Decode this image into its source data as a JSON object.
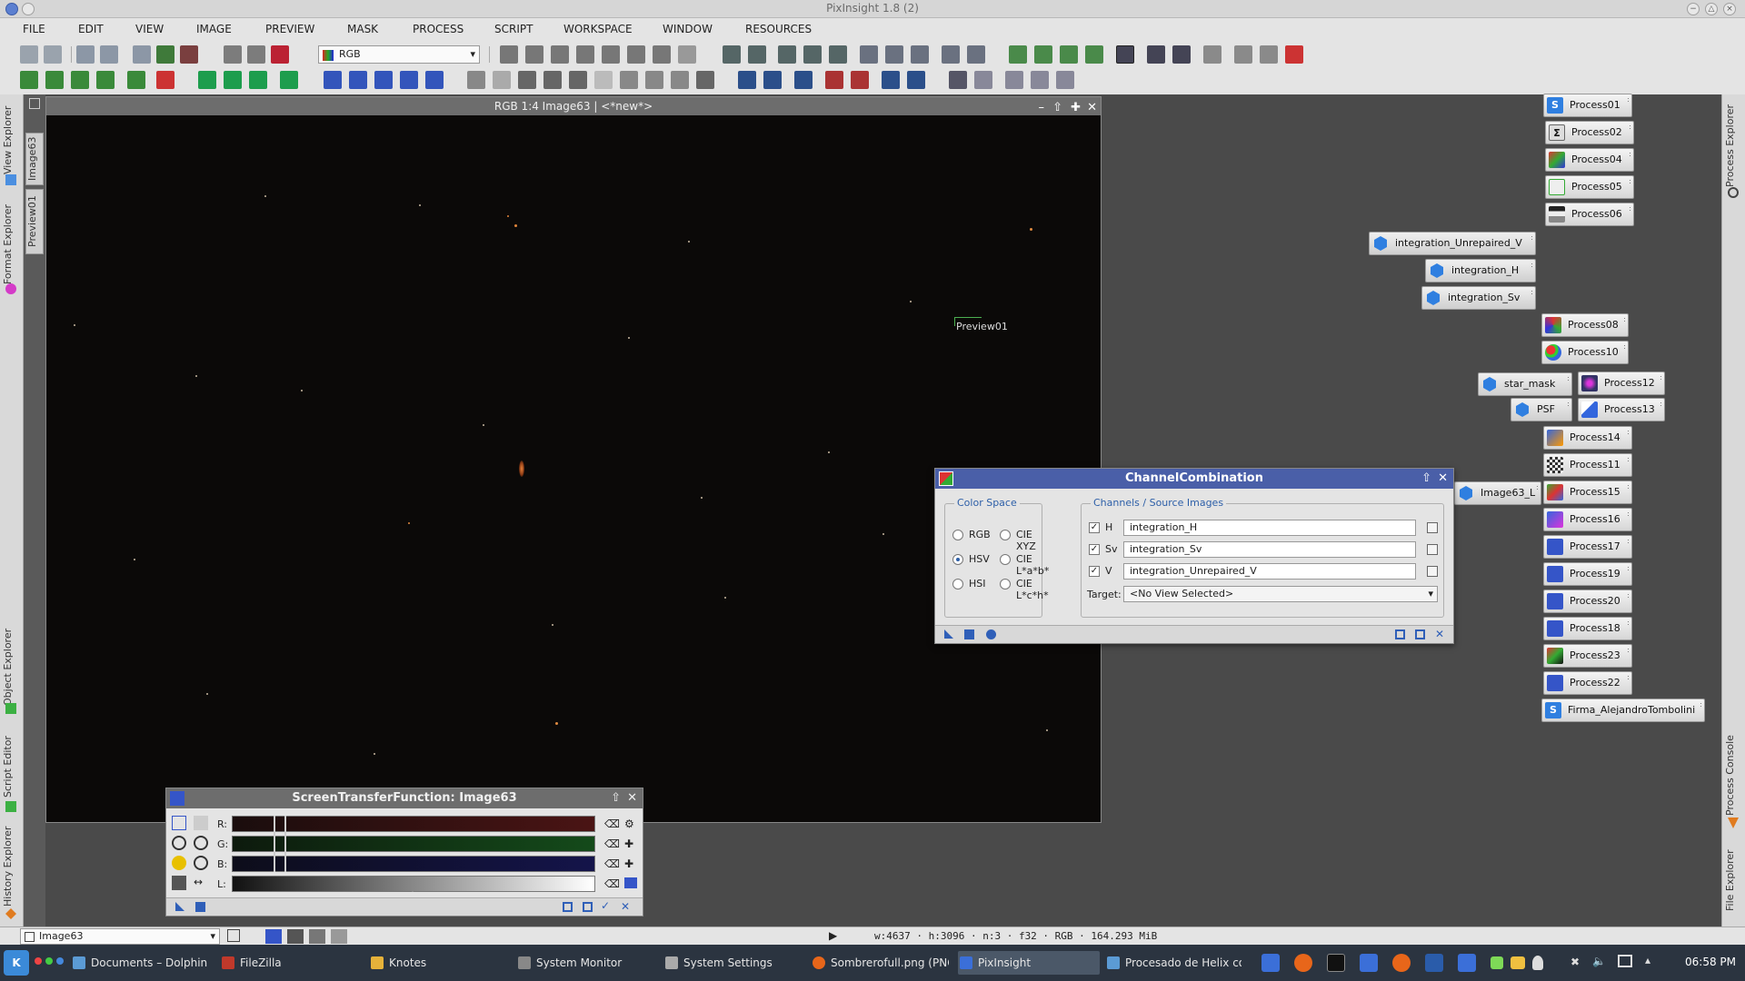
{
  "app": {
    "title": "PixInsight 1.8 (2)"
  },
  "menu": [
    "FILE",
    "EDIT",
    "VIEW",
    "IMAGE",
    "PREVIEW",
    "MASK",
    "PROCESS",
    "SCRIPT",
    "WORKSPACE",
    "WINDOW",
    "RESOURCES"
  ],
  "toolbar": {
    "colorspace_value": "RGB"
  },
  "left_dock": {
    "tabs": [
      "View Explorer",
      "Format Explorer",
      "Object Explorer",
      "Script Editor",
      "History Explorer"
    ]
  },
  "view_tabs": [
    "Image63",
    "Preview01"
  ],
  "right_dock": {
    "tabs": [
      "Process Explorer",
      "Process Console",
      "File Explorer"
    ]
  },
  "image_window": {
    "title": "RGB 1:4 Image63 | <*new*>",
    "preview_label": "Preview01"
  },
  "channel_combination": {
    "title": "ChannelCombination",
    "color_space_label": "Color Space",
    "color_spaces": [
      {
        "label": "RGB",
        "selected": false
      },
      {
        "label": "CIE XYZ",
        "selected": false
      },
      {
        "label": "HSV",
        "selected": true
      },
      {
        "label": "CIE L*a*b*",
        "selected": false
      },
      {
        "label": "HSI",
        "selected": false
      },
      {
        "label": "CIE L*c*h*",
        "selected": false
      }
    ],
    "channels_label": "Channels / Source Images",
    "channels": [
      {
        "label": "H",
        "checked": true,
        "value": "integration_H"
      },
      {
        "label": "Sv",
        "checked": true,
        "value": "integration_Sv"
      },
      {
        "label": "V",
        "checked": true,
        "value": "integration_Unrepaired_V"
      }
    ],
    "target_label": "Target:",
    "target_value": "<No View Selected>"
  },
  "stf": {
    "title": "ScreenTransferFunction: Image63",
    "channels": [
      "R:",
      "G:",
      "B:",
      "L:"
    ]
  },
  "process_icons": [
    {
      "label": "Process01",
      "icon": "S"
    },
    {
      "label": "Process02",
      "icon": "Σ"
    },
    {
      "label": "Process04",
      "icon": ""
    },
    {
      "label": "Process05",
      "icon": ""
    },
    {
      "label": "Process06",
      "icon": ""
    },
    {
      "label": "integration_Unrepaired_V",
      "icon": "cube"
    },
    {
      "label": "integration_H",
      "icon": "cube"
    },
    {
      "label": "integration_Sv",
      "icon": "cube"
    },
    {
      "label": "Process08",
      "icon": ""
    },
    {
      "label": "Process10",
      "icon": ""
    },
    {
      "label": "star_mask",
      "icon": "cube"
    },
    {
      "label": "Process12",
      "icon": ""
    },
    {
      "label": "PSF",
      "icon": "cube"
    },
    {
      "label": "Process13",
      "icon": ""
    },
    {
      "label": "Process14",
      "icon": ""
    },
    {
      "label": "Process11",
      "icon": ""
    },
    {
      "label": "Image63_L",
      "icon": "cube"
    },
    {
      "label": "Process15",
      "icon": ""
    },
    {
      "label": "Process16",
      "icon": ""
    },
    {
      "label": "Process17",
      "icon": ""
    },
    {
      "label": "Process19",
      "icon": ""
    },
    {
      "label": "Process20",
      "icon": ""
    },
    {
      "label": "Process18",
      "icon": ""
    },
    {
      "label": "Process23",
      "icon": ""
    },
    {
      "label": "Process22",
      "icon": ""
    },
    {
      "label": "Firma_AlejandroTombolini",
      "icon": "S"
    }
  ],
  "statusbar": {
    "view_selector": "Image63",
    "info": "w:4637 · h:3096 · n:3 · f32 · RGB · 164.293 MiB"
  },
  "taskbar": {
    "tasks": [
      "Documents – Dolphin",
      "FileZilla",
      "Knotes",
      "System Monitor",
      "System Settings",
      "Sombrerofull.png (PNG",
      "PixInsight",
      "Procesado de Helix co"
    ],
    "clock": "06:58 PM"
  }
}
